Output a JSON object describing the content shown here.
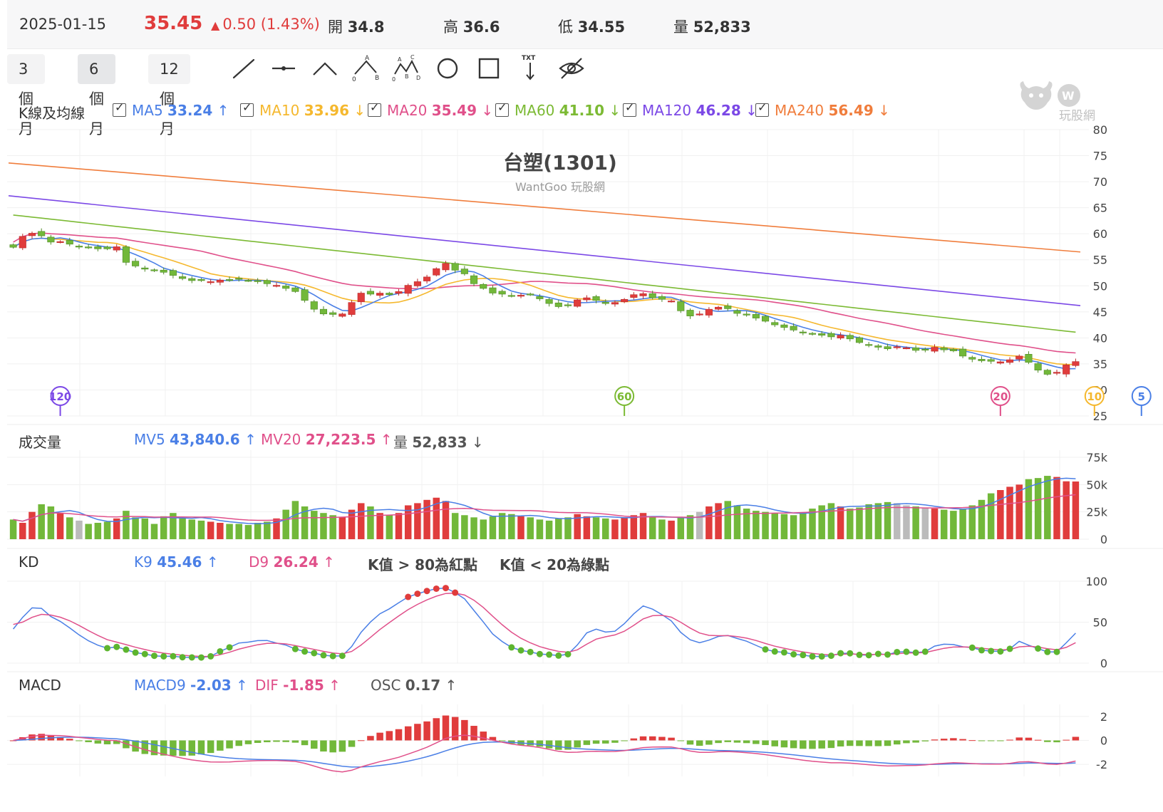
{
  "header": {
    "date": "2025-01-15",
    "price": "35.45",
    "change": "0.50 (1.43%)",
    "open_label": "開",
    "open": "34.8",
    "high_label": "高",
    "high": "36.6",
    "low_label": "低",
    "low": "34.55",
    "volume_label": "量",
    "volume": "52,833"
  },
  "toolbar": {
    "ranges": [
      "3 個月",
      "6 個月",
      "12 個月"
    ],
    "active_range": "6 個月",
    "tools": [
      "line-tool-icon",
      "horizontal-line-tool-icon",
      "angle-tool-icon",
      "abc-pattern-tool-icon",
      "abcd-pattern-tool-icon",
      "circle-tool-icon",
      "rectangle-tool-icon",
      "text-tool-icon",
      "hide-drawings-icon"
    ],
    "text_tool_label": "TXT"
  },
  "price_legend": {
    "title": "K線及均線",
    "items": [
      {
        "name": "MA5",
        "value": "33.24",
        "dir": "↑",
        "color": "#4a7fe6"
      },
      {
        "name": "MA10",
        "value": "33.96",
        "dir": "↓",
        "color": "#f5b82e"
      },
      {
        "name": "MA20",
        "value": "35.49",
        "dir": "↓",
        "color": "#e0508a"
      },
      {
        "name": "MA60",
        "value": "41.10",
        "dir": "↓",
        "color": "#7cba34"
      },
      {
        "name": "MA120",
        "value": "46.28",
        "dir": "↓",
        "color": "#7b48e6"
      },
      {
        "name": "MA240",
        "value": "56.49",
        "dir": "↓",
        "color": "#f07d3c"
      }
    ]
  },
  "volume_legend": {
    "title": "成交量",
    "items": [
      {
        "name": "MV5",
        "value": "43,840.6",
        "dir": "↑",
        "color": "#4a7fe6"
      },
      {
        "name": "MV20",
        "value": "27,223.5",
        "dir": "↑",
        "color": "#e0508a"
      },
      {
        "name": "量",
        "value": "52,833",
        "dir": "↓",
        "color": "#555555"
      }
    ]
  },
  "kd_legend": {
    "title": "KD",
    "items": [
      {
        "name": "K9",
        "value": "45.46",
        "dir": "↑",
        "color": "#4a7fe6"
      },
      {
        "name": "D9",
        "value": "26.24",
        "dir": "↑",
        "color": "#e0508a"
      }
    ],
    "notes": [
      "K值 > 80為紅點",
      "K值 < 20為綠點"
    ]
  },
  "macd_legend": {
    "title": "MACD",
    "items": [
      {
        "name": "MACD9",
        "value": "-2.03",
        "dir": "↑",
        "color": "#4a7fe6"
      },
      {
        "name": "DIF",
        "value": "-1.85",
        "dir": "↑",
        "color": "#e0508a"
      },
      {
        "name": "OSC",
        "value": "0.17",
        "dir": "↑",
        "color": "#555555"
      }
    ]
  },
  "logo_text": "玩股網",
  "chart_data": {
    "type": "candlestick",
    "title": "台塑(1301)",
    "subtitle": "WantGoo 玩股網",
    "colors": {
      "up": "#e03c3c",
      "down": "#72b83a",
      "flat": "#bbbbbb",
      "MA5": "#4a7fe6",
      "MA10": "#f5b82e",
      "MA20": "#e0508a",
      "MA60": "#7cba34",
      "MA120": "#7b48e6",
      "MA240": "#f07d3c"
    },
    "price_axis": {
      "ylim": [
        25,
        80
      ],
      "ticks": [
        25,
        30,
        35,
        40,
        45,
        50,
        55,
        60,
        65,
        70,
        75,
        80
      ]
    },
    "volume_axis": {
      "ylim": [
        0,
        75000
      ],
      "tick_labels": [
        "0",
        "25k",
        "50k",
        "75k"
      ],
      "ticks": [
        0,
        25000,
        50000,
        75000
      ]
    },
    "kd_axis": {
      "ylim": [
        0,
        100
      ],
      "ticks": [
        0,
        50,
        100
      ]
    },
    "macd_axis": {
      "ylim": [
        -3,
        3
      ],
      "ticks": [
        -2,
        0,
        2
      ]
    },
    "ma_markers": [
      {
        "label": "120",
        "index": 5,
        "color": "#7b48e6"
      },
      {
        "label": "60",
        "index": 65,
        "color": "#7cba34"
      },
      {
        "label": "20",
        "index": 105,
        "color": "#e0508a"
      },
      {
        "label": "10",
        "index": 115,
        "color": "#f5b82e"
      },
      {
        "label": "5",
        "index": 120,
        "color": "#4a7fe6"
      }
    ],
    "close": [
      57.4,
      59.5,
      60.1,
      59.6,
      58.4,
      58.5,
      58.0,
      57.6,
      57.4,
      57.1,
      57.1,
      57.5,
      54.5,
      53.8,
      53.2,
      52.9,
      52.6,
      52.0,
      51.4,
      51.0,
      51.0,
      50.8,
      51.1,
      51.1,
      51.3,
      51.0,
      50.8,
      50.4,
      50.1,
      49.5,
      48.9,
      47.2,
      45.5,
      44.6,
      44.5,
      44.6,
      46.8,
      48.6,
      48.4,
      48.6,
      48.3,
      48.9,
      50.1,
      50.8,
      51.7,
      53.3,
      54.3,
      53.0,
      52.3,
      50.4,
      49.5,
      48.6,
      48.4,
      48.1,
      48.2,
      48.3,
      47.5,
      46.6,
      46.0,
      46.3,
      47.3,
      47.7,
      47.2,
      46.6,
      46.8,
      47.4,
      48.3,
      48.5,
      47.7,
      47.4,
      47.1,
      45.2,
      44.2,
      44.6,
      45.5,
      45.9,
      45.6,
      44.7,
      44.4,
      43.8,
      43.2,
      42.5,
      42.0,
      41.5,
      41.0,
      40.7,
      40.5,
      40.2,
      40.5,
      39.8,
      39.1,
      38.6,
      38.2,
      37.9,
      38.3,
      38.1,
      37.6,
      37.8,
      38.2,
      37.7,
      37.5,
      36.5,
      35.9,
      35.6,
      35.5,
      35.4,
      35.8,
      36.5,
      35.3,
      33.8,
      33.0,
      33.4,
      34.8,
      35.45
    ],
    "volume": [
      18000,
      15000,
      25000,
      32000,
      30000,
      24000,
      20000,
      17000,
      14000,
      15000,
      16000,
      19000,
      26000,
      20000,
      19000,
      14000,
      21000,
      24000,
      19000,
      18000,
      17000,
      16000,
      15000,
      14000,
      14000,
      13000,
      15000,
      16000,
      19000,
      27000,
      35000,
      30000,
      26000,
      24000,
      22000,
      20000,
      27000,
      33000,
      30000,
      24000,
      22000,
      24000,
      31000,
      33000,
      36000,
      38000,
      35000,
      24000,
      22000,
      20000,
      18000,
      21000,
      24000,
      23000,
      21000,
      20000,
      18000,
      17000,
      19000,
      20000,
      23000,
      21000,
      20000,
      19000,
      18000,
      20000,
      22000,
      24000,
      20000,
      18000,
      17000,
      20000,
      22000,
      25000,
      30000,
      33000,
      35000,
      31000,
      28000,
      26000,
      25000,
      24000,
      23000,
      22000,
      24000,
      28000,
      31000,
      33000,
      30000,
      28000,
      29000,
      32000,
      33000,
      34000,
      33000,
      31000,
      30000,
      29000,
      28000,
      27000,
      26000,
      28000,
      31000,
      36000,
      42000,
      45000,
      48000,
      50000,
      55000,
      56000,
      58000,
      57000,
      53000,
      52833
    ]
  }
}
